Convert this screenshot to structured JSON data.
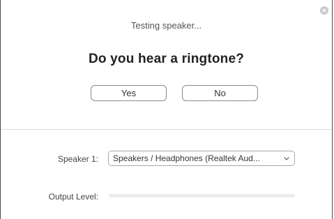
{
  "dialog": {
    "status_text": "Testing speaker...",
    "question": "Do you hear a ringtone?",
    "yes_label": "Yes",
    "no_label": "No",
    "close_icon": "close-icon"
  },
  "speaker": {
    "label": "Speaker 1:",
    "selected": "Speakers / Headphones (Realtek Aud...",
    "dropdown_icon": "chevron-down-icon"
  },
  "output": {
    "label": "Output Level:",
    "level": 0
  },
  "colors": {
    "accent": "#2d8cff",
    "track": "#ececec",
    "close": "#c9c9cc"
  }
}
